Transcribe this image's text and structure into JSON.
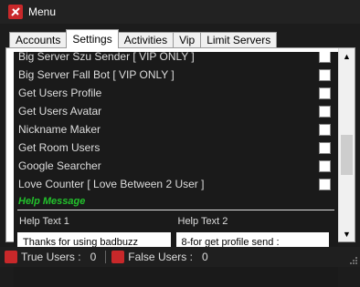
{
  "window": {
    "title": "Menu"
  },
  "tabs": [
    {
      "label": "Accounts"
    },
    {
      "label": "Settings"
    },
    {
      "label": "Activities"
    },
    {
      "label": "Vip"
    },
    {
      "label": "Limit Servers"
    }
  ],
  "settings": [
    {
      "label": "Big Server Szu Sender [ VIP ONLY ]",
      "checked": false
    },
    {
      "label": "Big Server Fall Bot [ VIP ONLY ]",
      "checked": false
    },
    {
      "label": "Get Users Profile",
      "checked": false
    },
    {
      "label": "Get Users Avatar",
      "checked": false
    },
    {
      "label": "Nickname Maker",
      "checked": false
    },
    {
      "label": "Get Room Users",
      "checked": false
    },
    {
      "label": "Google Searcher",
      "checked": false
    },
    {
      "label": "Love Counter [ Love Between 2 User ]",
      "checked": false
    }
  ],
  "help": {
    "heading": "Help Message",
    "text1_label": "Help Text 1",
    "text1_value": "Thanks for using badbuzz",
    "text2_label": "Help Text 2",
    "text2_value": "8-for get profile send :"
  },
  "status": {
    "true_users_label": "True Users :",
    "true_users_count": "0",
    "false_users_label": "False Users :",
    "false_users_count": "0"
  },
  "colors": {
    "help_heading": "#22c22c",
    "brand_red": "#c8282a"
  }
}
